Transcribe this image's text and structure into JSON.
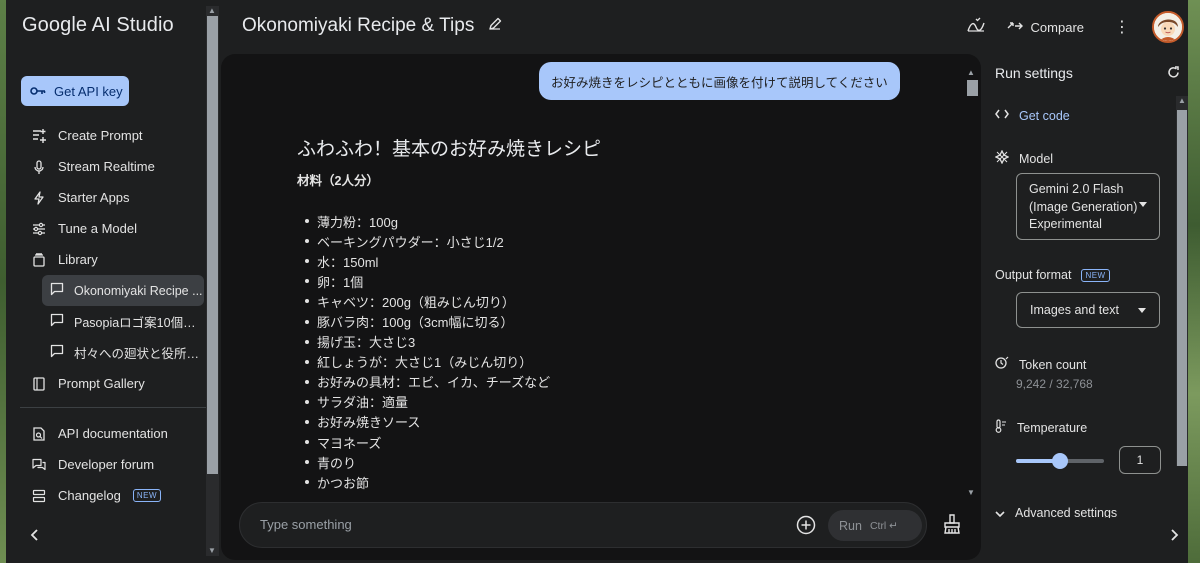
{
  "brand": "Google AI Studio",
  "sidebar": {
    "api_key_label": "Get API key",
    "nav": [
      {
        "label": "Create Prompt",
        "icon": "create-prompt-icon"
      },
      {
        "label": "Stream Realtime",
        "icon": "mic-icon"
      },
      {
        "label": "Starter Apps",
        "icon": "bolt-icon"
      },
      {
        "label": "Tune a Model",
        "icon": "tune-icon"
      },
      {
        "label": "Library",
        "icon": "library-icon"
      }
    ],
    "library_items": [
      {
        "label": "Okonomiyaki Recipe ...",
        "active": true
      },
      {
        "label": "Pasopiaロゴ案10個提案",
        "active": false
      },
      {
        "label": "村々への廻状と役所の...",
        "active": false
      }
    ],
    "gallery_label": "Prompt Gallery",
    "footer": [
      {
        "label": "API documentation"
      },
      {
        "label": "Developer forum"
      },
      {
        "label": "Changelog",
        "badge": "NEW"
      }
    ]
  },
  "header": {
    "title": "Okonomiyaki Recipe & Tips",
    "compare_label": "Compare"
  },
  "chat": {
    "user_message": "お好み焼きをレシピとともに画像を付けて説明してください",
    "heading": "ふわふわ！基本のお好み焼きレシピ",
    "subheading": "材料（2人分）",
    "ingredients": [
      "薄力粉：100g",
      "ベーキングパウダー：小さじ1/2",
      "水：150ml",
      "卵：1個",
      "キャベツ：200g（粗みじん切り）",
      "豚バラ肉：100g（3cm幅に切る）",
      "揚げ玉：大さじ3",
      "紅しょうが：大さじ1（みじん切り）",
      "お好みの具材：エビ、イカ、チーズなど",
      "サラダ油：適量",
      "お好み焼きソース",
      "マヨネーズ",
      "青のり",
      "かつお節"
    ],
    "input_placeholder": "Type something",
    "run_label": "Run",
    "run_shortcut": "Ctrl ↵"
  },
  "settings": {
    "title": "Run settings",
    "get_code": "Get code",
    "model_label": "Model",
    "model_value_lines": [
      "Gemini 2.0 Flash",
      "(Image Generation)",
      "Experimental"
    ],
    "output_format_label": "Output format",
    "output_format_badge": "NEW",
    "output_format_value": "Images and text",
    "token_count_label": "Token count",
    "token_count_value": "9,242 / 32,768",
    "temperature_label": "Temperature",
    "temperature_value": "1",
    "temperature_fraction": 0.5,
    "advanced_label": "Advanced settings"
  },
  "colors": {
    "accent": "#a8c7fa",
    "background": "#1e1f20",
    "chat_background": "#131314"
  }
}
